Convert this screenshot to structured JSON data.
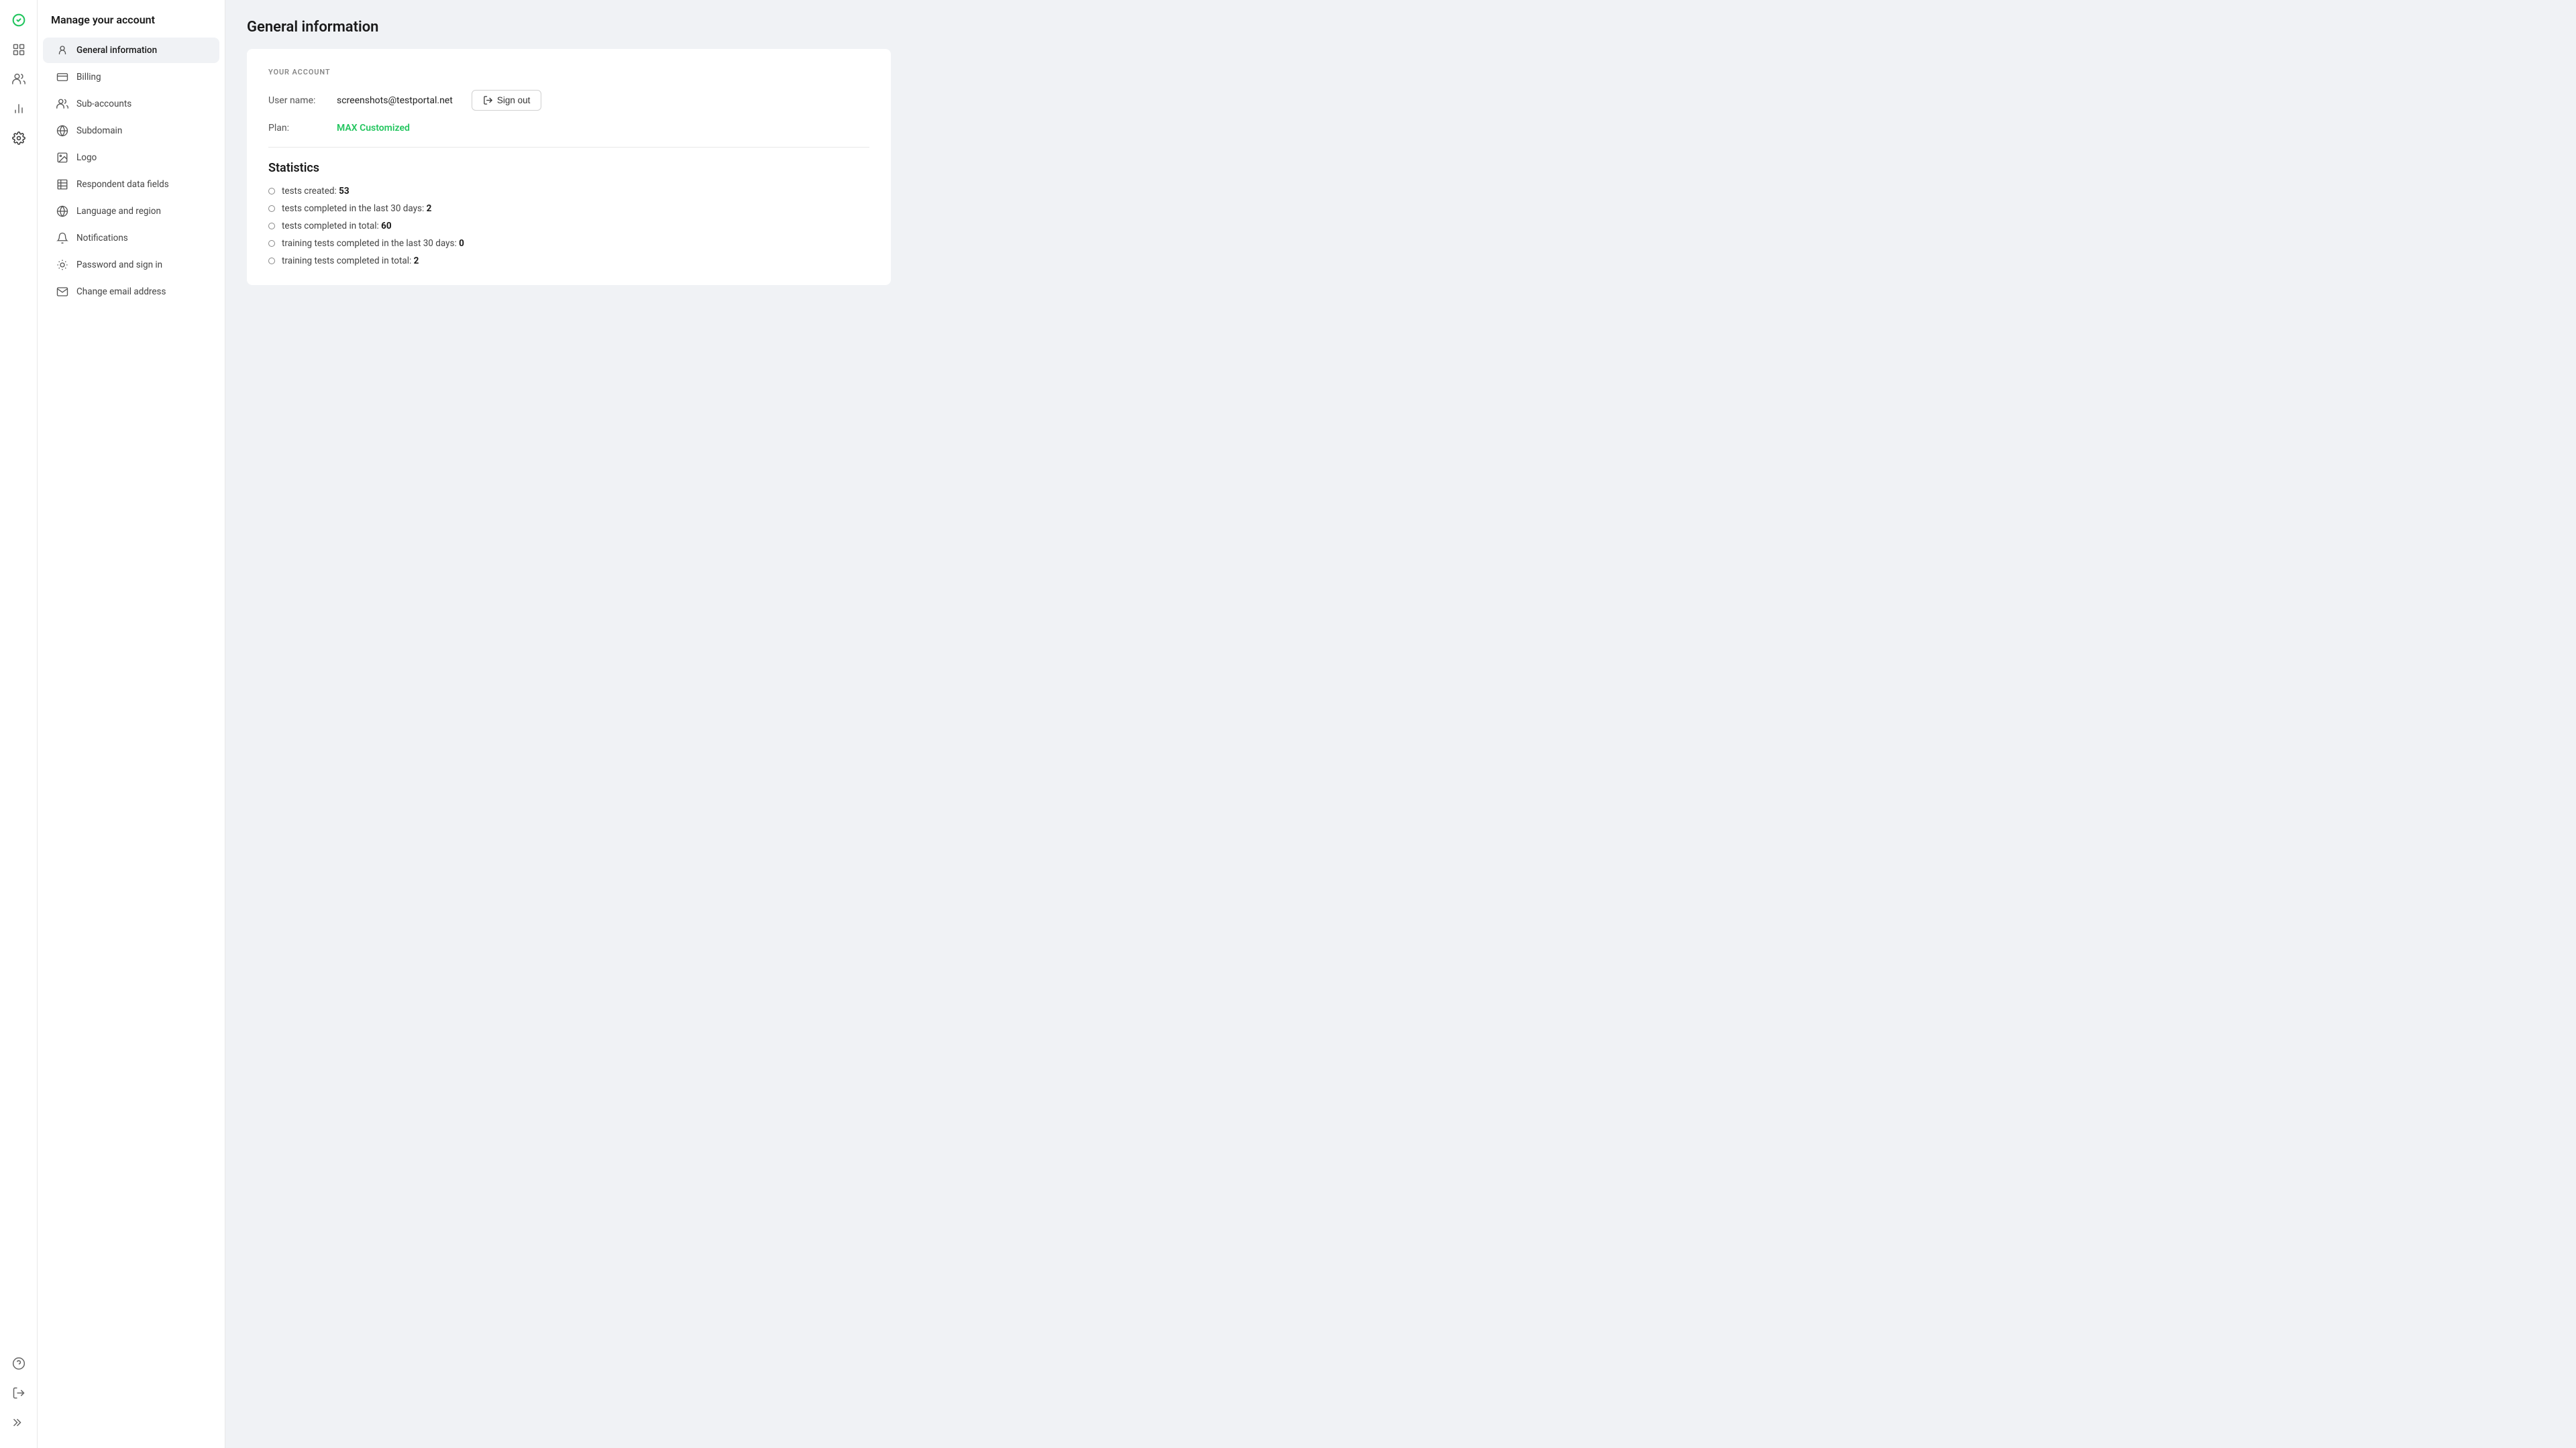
{
  "sidebar": {
    "title": "Manage your account",
    "items": [
      {
        "id": "general-information",
        "label": "General information",
        "active": true
      },
      {
        "id": "billing",
        "label": "Billing",
        "active": false
      },
      {
        "id": "sub-accounts",
        "label": "Sub-accounts",
        "active": false
      },
      {
        "id": "subdomain",
        "label": "Subdomain",
        "active": false
      },
      {
        "id": "logo",
        "label": "Logo",
        "active": false
      },
      {
        "id": "respondent-data-fields",
        "label": "Respondent data fields",
        "active": false
      },
      {
        "id": "language-and-region",
        "label": "Language and region",
        "active": false
      },
      {
        "id": "notifications",
        "label": "Notifications",
        "active": false
      },
      {
        "id": "password-and-sign-in",
        "label": "Password and sign in",
        "active": false
      },
      {
        "id": "change-email-address",
        "label": "Change email address",
        "active": false
      }
    ]
  },
  "page": {
    "title": "General information"
  },
  "account_section": {
    "label": "YOUR ACCOUNT",
    "username_label": "User name:",
    "username_value": "screenshots@testportal.net",
    "plan_label": "Plan:",
    "plan_value": "MAX Customized",
    "sign_out_label": "Sign out"
  },
  "statistics": {
    "title": "Statistics",
    "items": [
      {
        "text": "tests created:",
        "value": "53"
      },
      {
        "text": "tests completed in the last 30 days:",
        "value": "2"
      },
      {
        "text": "tests completed in total:",
        "value": "60"
      },
      {
        "text": "training tests completed in the last 30 days:",
        "value": "0"
      },
      {
        "text": "training tests completed in total:",
        "value": "2"
      }
    ]
  },
  "colors": {
    "brand_green": "#22c55e",
    "active_bg": "#f0f2f5"
  }
}
